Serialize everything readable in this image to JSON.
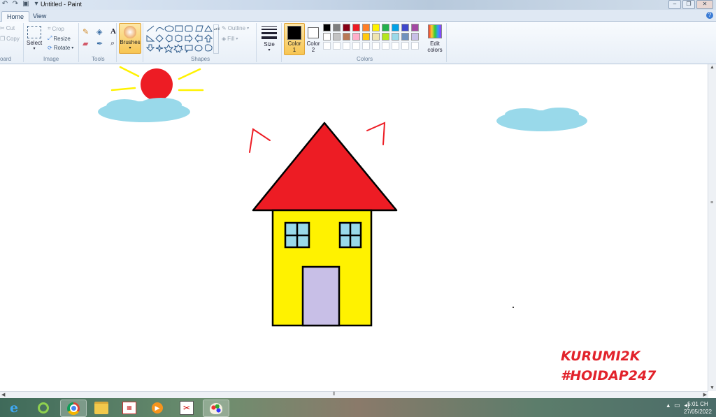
{
  "window": {
    "title": "Untitled - Paint",
    "controls": [
      "–",
      "❐",
      "✕"
    ]
  },
  "tabs": [
    {
      "label": "Home",
      "active": true
    },
    {
      "label": "View",
      "active": false
    }
  ],
  "ribbon": {
    "clipboard": {
      "label": "oard",
      "cut": "Cut",
      "copy": "Copy"
    },
    "image": {
      "label": "Image",
      "select": "Select",
      "crop": "Crop",
      "resize": "Resize",
      "rotate": "Rotate"
    },
    "tools": {
      "label": "Tools"
    },
    "brushes": {
      "label": "Brushes"
    },
    "shapes": {
      "label": "Shapes",
      "outline": "Outline",
      "fill": "Fill"
    },
    "size": {
      "label": "Size"
    },
    "colors": {
      "label": "Colors",
      "color1": "Color\n1",
      "color2": "Color\n2",
      "edit": "Edit\ncolors",
      "color1_value": "#000000",
      "color2_value": "#ffffff",
      "palette_row1": [
        "#000000",
        "#7f7f7f",
        "#880015",
        "#ed1c24",
        "#ff7f27",
        "#fff200",
        "#22b14c",
        "#00a2e8",
        "#3f48cc",
        "#a349a4"
      ],
      "palette_row2": [
        "#ffffff",
        "#c3c3c3",
        "#b97a57",
        "#ffaec9",
        "#ffc90e",
        "#efe4b0",
        "#b5e61d",
        "#99d9ea",
        "#7092be",
        "#c8bfe7"
      ]
    }
  },
  "drawing": {
    "colors": {
      "sun": "#ed1c24",
      "rays": "#fff200",
      "cloud": "#99d9ea",
      "roof": "#ed1c24",
      "wall": "#fff200",
      "window": "#99d9ea",
      "door": "#c8bfe7",
      "outline": "#000000"
    }
  },
  "watermark": {
    "line1": "KURUMI2K",
    "line2": "#HOIDAP247"
  },
  "taskbar": {
    "apps": [
      "internet-explorer-icon",
      "chrome-icon",
      "file-explorer-icon",
      "app-icon",
      "media-player-icon",
      "snipping-icon",
      "paint-icon"
    ],
    "time": "5:01 CH",
    "date": "27/05/2022"
  }
}
